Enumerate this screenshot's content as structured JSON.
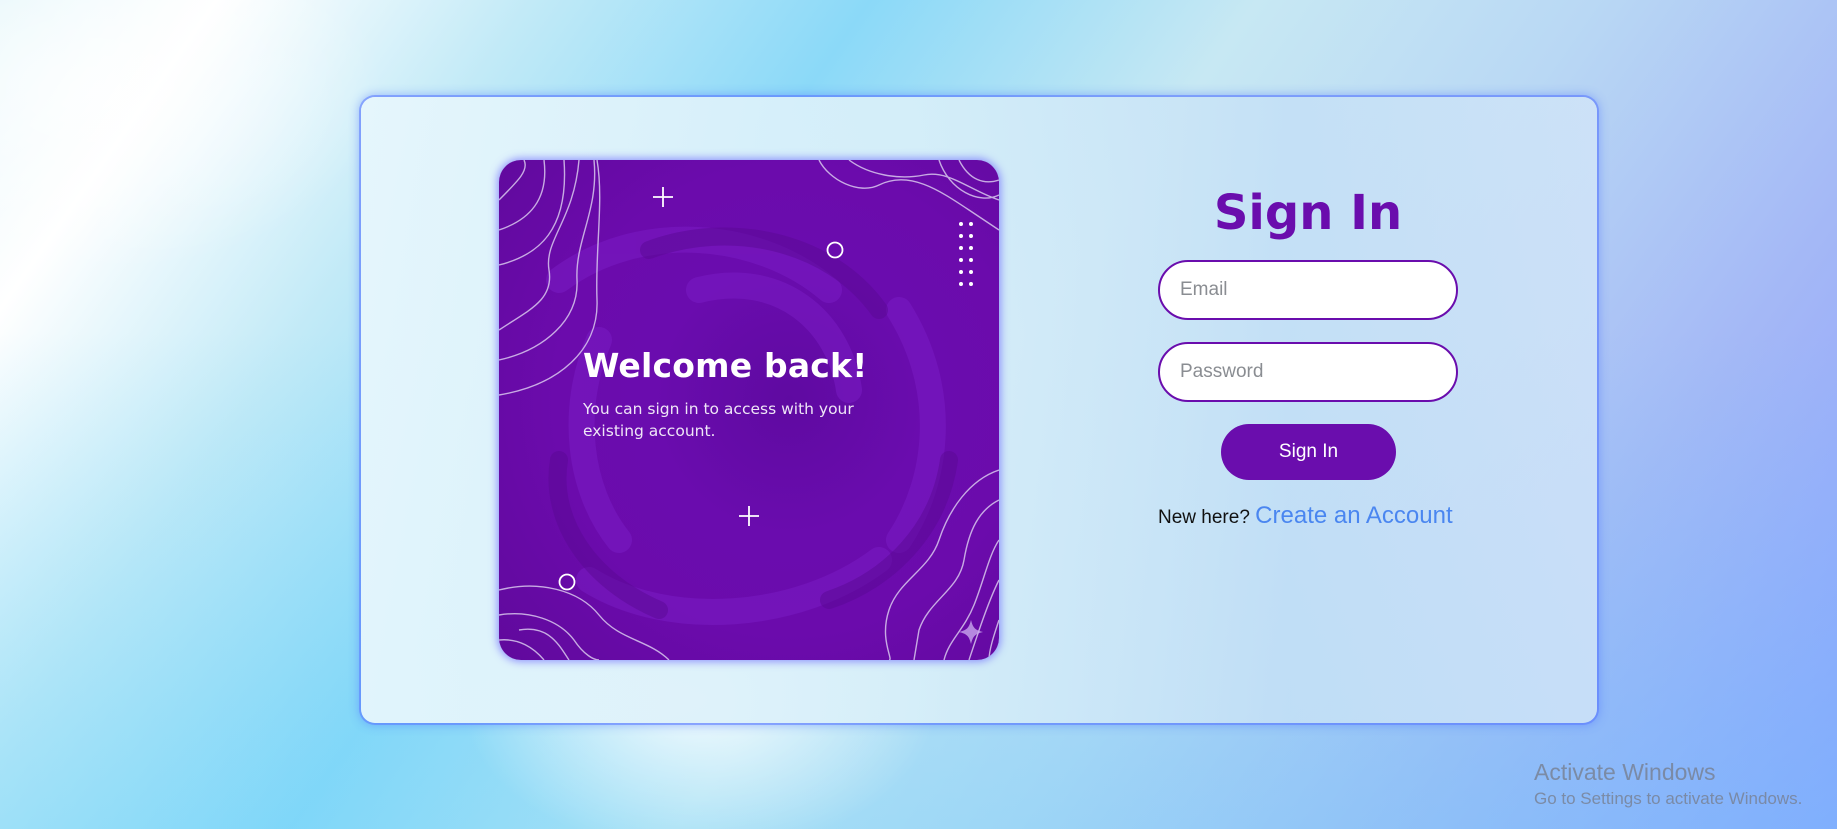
{
  "hero": {
    "title": "Welcome back!",
    "subtitle": "You can sign in to access with your existing account."
  },
  "form": {
    "title": "Sign In",
    "email_placeholder": "Email",
    "password_placeholder": "Password",
    "submit_label": "Sign In",
    "register_prompt": "New here?",
    "register_link": "Create an Account"
  },
  "watermark": {
    "title": "Activate Windows",
    "subtitle": "Go to Settings to activate Windows."
  },
  "colors": {
    "primary": "#6a0dad",
    "link": "#4a86f0",
    "card_glow": "#5c7cff"
  }
}
